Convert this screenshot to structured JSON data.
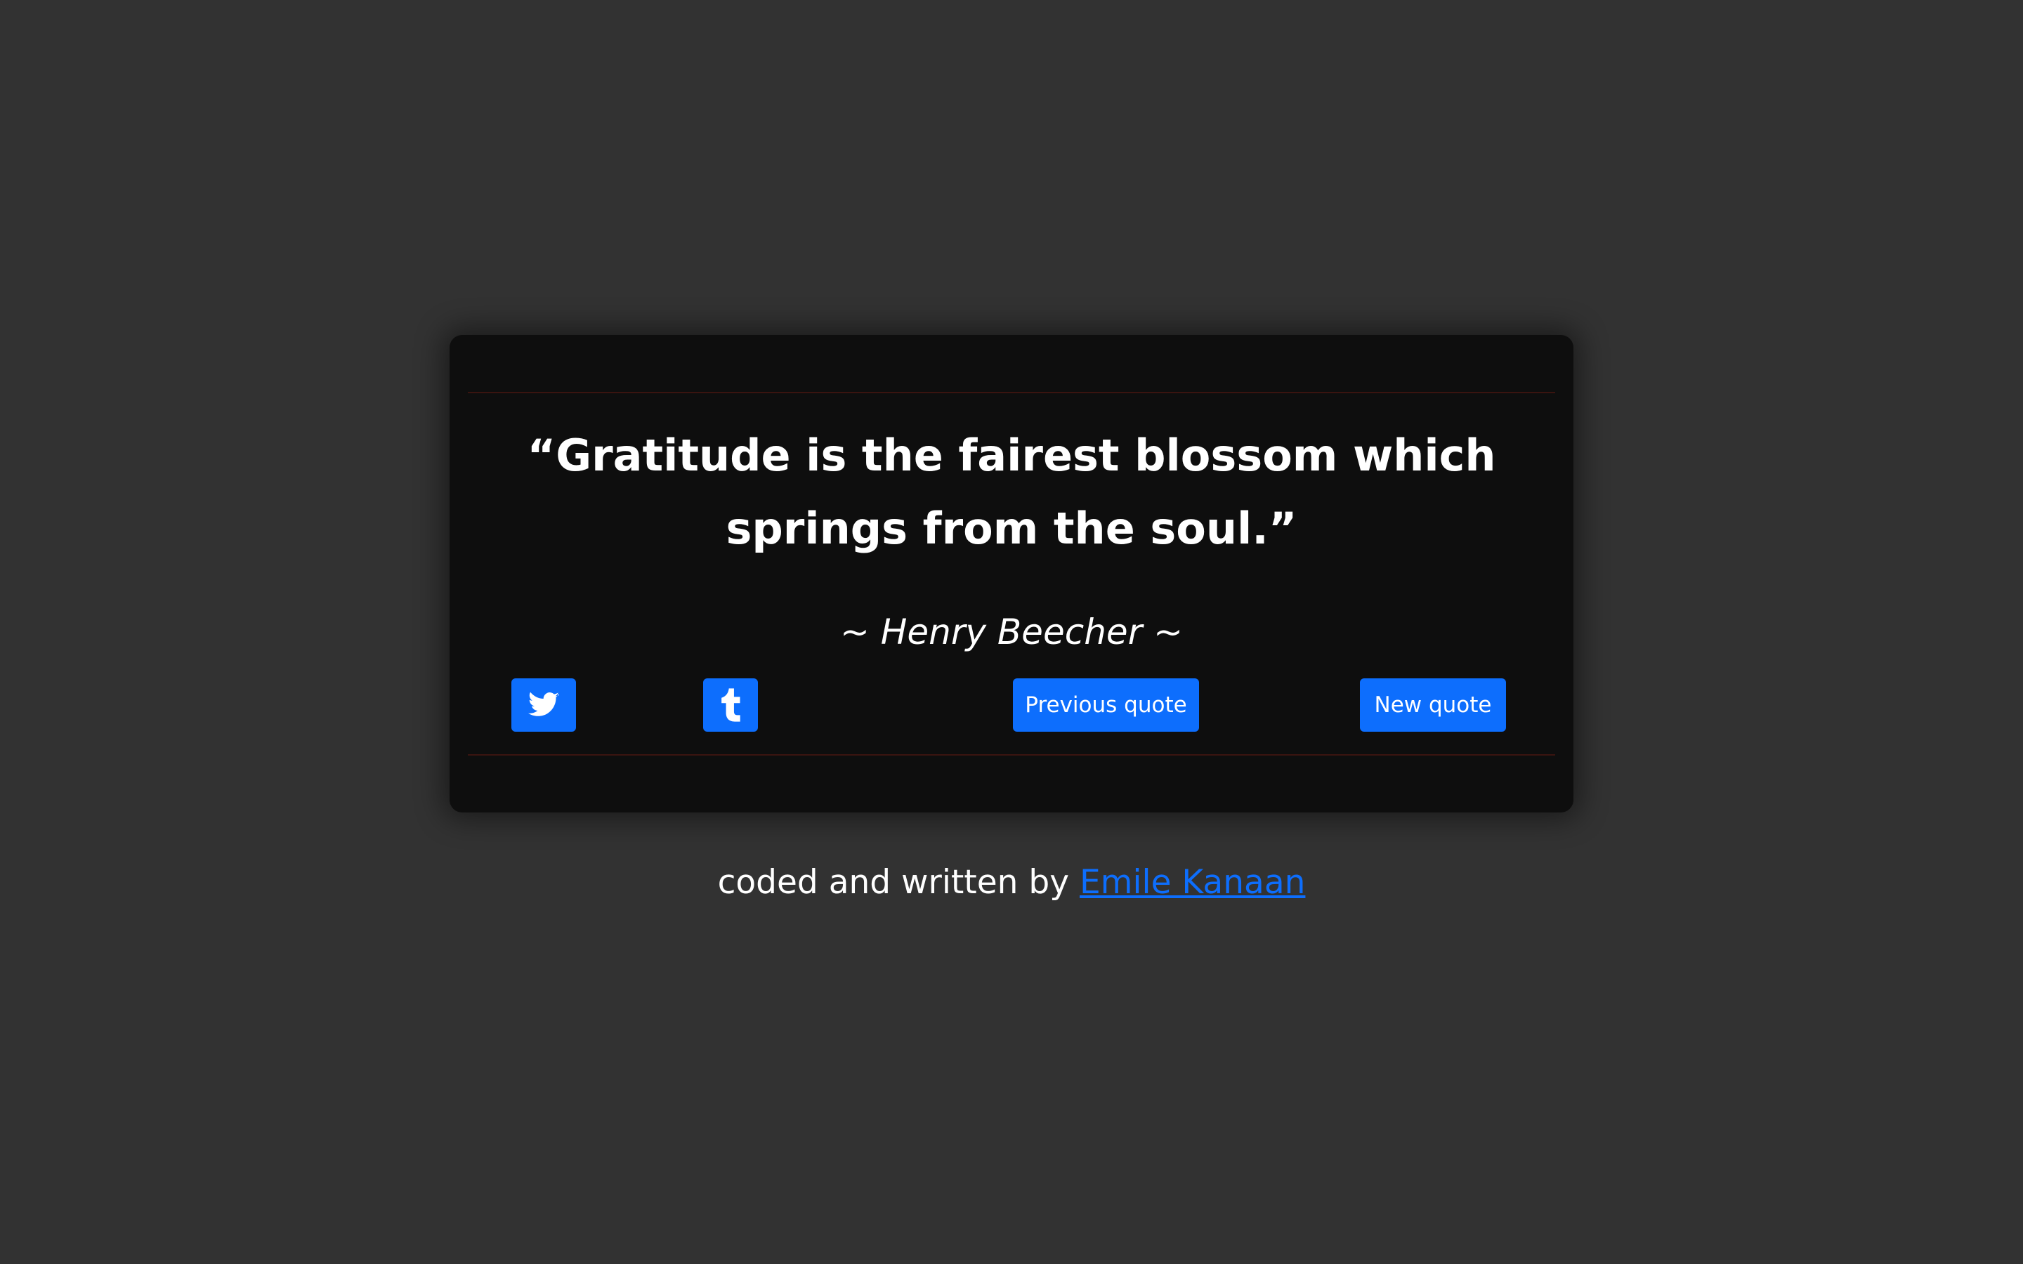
{
  "quote": {
    "text": "“Gratitude is the fairest blossom which springs from the soul.”",
    "author": "~ Henry Beecher ~"
  },
  "buttons": {
    "twitter_icon": "twitter-icon",
    "tumblr_icon": "tumblr-icon",
    "previous_label": "Previous quote",
    "new_label": "New quote"
  },
  "footer": {
    "prefix": "coded and written by ",
    "author_link": "Emile Kanaan"
  },
  "colors": {
    "background": "#323232",
    "card": "#0e0e0e",
    "accent": "#0d6efd",
    "divider": "#3a1410",
    "text": "#ffffff"
  }
}
